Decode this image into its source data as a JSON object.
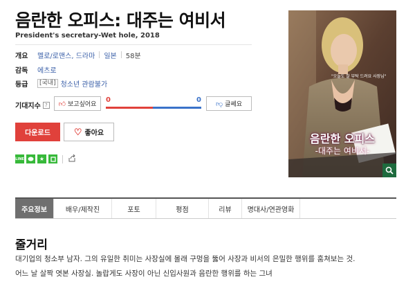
{
  "movie": {
    "title": "음란한 오피스: 대주는 여비서",
    "subtitle": "President's secretary-Wet hole, 2018"
  },
  "info": {
    "overview_label": "개요",
    "genre": "멜로/로맨스, 드라마",
    "country": "일본",
    "runtime": "58분",
    "director_label": "감독",
    "director": "에츠로",
    "rating_label": "등급",
    "rating_region": "[국내]",
    "rating": "청소년 관람불가"
  },
  "expectation": {
    "label": "기대지수",
    "help": "?",
    "want_label": "보고싶어요",
    "dont_label": "글쎄요",
    "want_count": "0",
    "dont_count": "0",
    "want_color": "#e0413b",
    "dont_color": "#3a72c9"
  },
  "actions": {
    "download_label": "다운로드",
    "like_label": "좋아요"
  },
  "share": {
    "icons": [
      "line-icon",
      "kakaotalk-icon",
      "bookmark-star-icon",
      "band-icon",
      "share-icon"
    ]
  },
  "poster": {
    "title": "음란한 오피스",
    "subtitle": "-대주는 여비서-",
    "tagline": "\"오늘도 잘 부탁 드려요 사장님\""
  },
  "tabs": [
    {
      "label": "주요정보",
      "active": true
    },
    {
      "label": "배우/제작진",
      "active": false
    },
    {
      "label": "포토",
      "active": false
    },
    {
      "label": "평점",
      "active": false
    },
    {
      "label": "리뷰",
      "active": false
    },
    {
      "label": "명대사/연관영화",
      "active": false
    }
  ],
  "synopsis": {
    "heading": "줄거리",
    "line1": "대기업의 청소부 남자. 그의 유일한 취미는 사장실에 몰래 구멍을 뚫어 사장과 비서의 은밀한 행위를 훔쳐보는 것.",
    "line2": "어느 날 살짝 엿본 사장실. 놀랍게도 사장이 아닌 신입사원과 음란한 행위를 하는 그녀"
  },
  "colors": {
    "accent": "#e0413b",
    "link": "#3a5fa8",
    "tab_active": "#6f6f6f"
  }
}
